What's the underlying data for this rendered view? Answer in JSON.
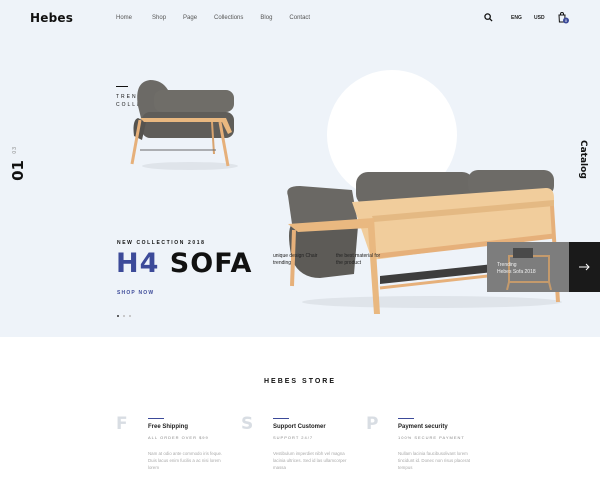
{
  "header": {
    "logo": "Hebes",
    "nav": [
      "Home",
      "Shop",
      "Page",
      "Collections",
      "Blog",
      "Contact"
    ],
    "lang": "ENG",
    "currency": "USD",
    "cart_count": "0"
  },
  "hero": {
    "slide_current": "01",
    "slide_total": "03",
    "trending": [
      "TRENDING SOFA",
      "COLLECTION"
    ],
    "new_collection": "NEW COLLECTION 2018",
    "title_part1": "H4",
    "title_part2": "SOFA",
    "feature1": "unique design Chair trending",
    "feature2": "the best material for the product",
    "shop_now": "SHOP NOW",
    "catalog": "Catalog",
    "next_slide": {
      "line1": "Trending",
      "line2": "Hebes Sofa 2018"
    }
  },
  "store": {
    "title": "HEBES STORE",
    "features": [
      {
        "letter": "F",
        "title": "Free Shipping",
        "subtitle": "ALL ORDER OVER $99",
        "desc": "Nam at odio ante commodo iris feque. Duis lacus enim fucilis a ac nisi lorem lorem"
      },
      {
        "letter": "S",
        "title": "Support Customer",
        "subtitle": "SUPPORT 24/7",
        "desc": "Vestibulum imperdiet nibh vel magna lacinia ultrices. Sed id las ullamcorper massa"
      },
      {
        "letter": "P",
        "title": "Payment security",
        "subtitle": "100% SECURE PAYMENT",
        "desc": "Nullam lacinia faucibusolivant lorem tincidunt id. Donec non risus placerat tempus"
      }
    ]
  },
  "colors": {
    "accent": "#3c4a99",
    "hero_bg": "#eef3f9",
    "dark": "#111111"
  }
}
